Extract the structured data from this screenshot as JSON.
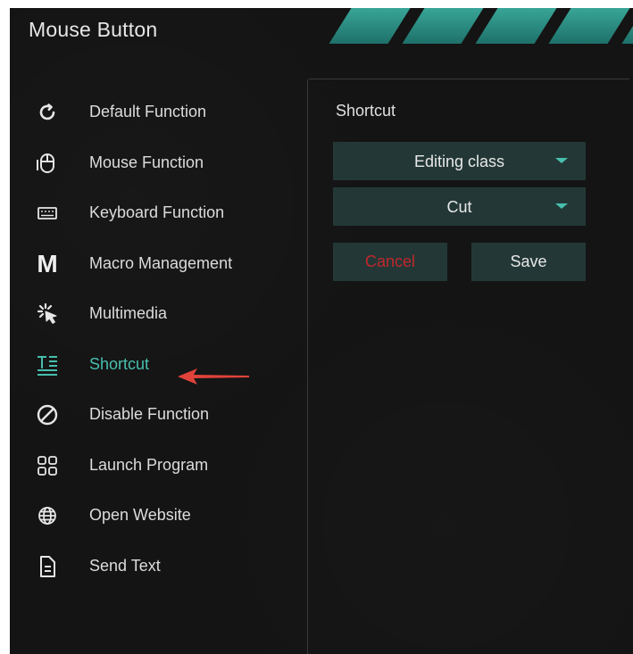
{
  "window": {
    "title": "Mouse Button"
  },
  "colors": {
    "background": "#141414",
    "accent": "#48bfae",
    "control_bg": "#233836",
    "cancel_text": "#c0262d",
    "arrow": "#e0433a"
  },
  "menu": {
    "active": "Shortcut",
    "items": [
      {
        "label": "Default Function",
        "icon": "refresh-icon"
      },
      {
        "label": "Mouse Function",
        "icon": "mouse-icon"
      },
      {
        "label": "Keyboard Function",
        "icon": "keyboard-icon"
      },
      {
        "label": "Macro Management",
        "icon": "macro-m-icon",
        "glyph": "M"
      },
      {
        "label": "Multimedia",
        "icon": "multimedia-icon"
      },
      {
        "label": "Shortcut",
        "icon": "shortcut-icon"
      },
      {
        "label": "Disable Function",
        "icon": "disable-icon"
      },
      {
        "label": "Launch Program",
        "icon": "grid-icon"
      },
      {
        "label": "Open Website",
        "icon": "globe-icon"
      },
      {
        "label": "Send Text",
        "icon": "document-icon"
      }
    ]
  },
  "shortcut_panel": {
    "title": "Shortcut",
    "category_dropdown": {
      "value": "Editing class"
    },
    "action_dropdown": {
      "value": "Cut"
    },
    "cancel_label": "Cancel",
    "save_label": "Save"
  },
  "annotation": {
    "type": "red-arrow",
    "points_to": "Shortcut"
  }
}
